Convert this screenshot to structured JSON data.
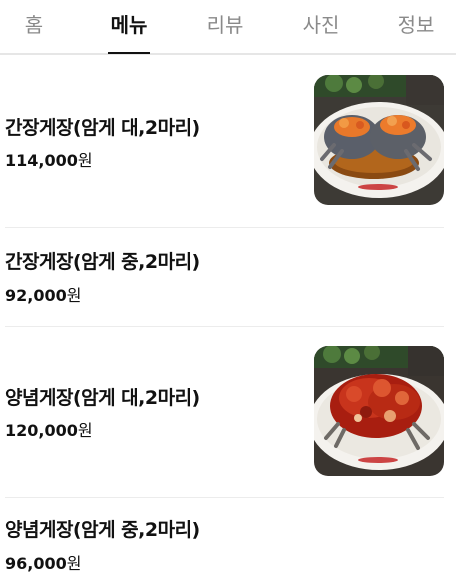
{
  "tabs": [
    {
      "label": "홈",
      "active": false
    },
    {
      "label": "메뉴",
      "active": true
    },
    {
      "label": "리뷰",
      "active": false
    },
    {
      "label": "사진",
      "active": false
    },
    {
      "label": "정보",
      "active": false
    }
  ],
  "menu": {
    "items": [
      {
        "name": "간장게장(암게 대,2마리)",
        "price": "114,000",
        "currency": "원",
        "has_photo": true,
        "photo": "soy-crab-icon"
      },
      {
        "name": "간장게장(암게 중,2마리)",
        "price": "92,000",
        "currency": "원",
        "has_photo": false
      },
      {
        "name": "양념게장(암게 대,2마리)",
        "price": "120,000",
        "currency": "원",
        "has_photo": true,
        "photo": "spicy-crab-icon"
      },
      {
        "name": "양념게장(암게 중,2마리)",
        "price": "96,000",
        "currency": "원",
        "has_photo": false
      }
    ]
  },
  "colors": {
    "active_tab": "#111111",
    "inactive_tab": "#8a8a8a",
    "divider": "#ececec"
  }
}
